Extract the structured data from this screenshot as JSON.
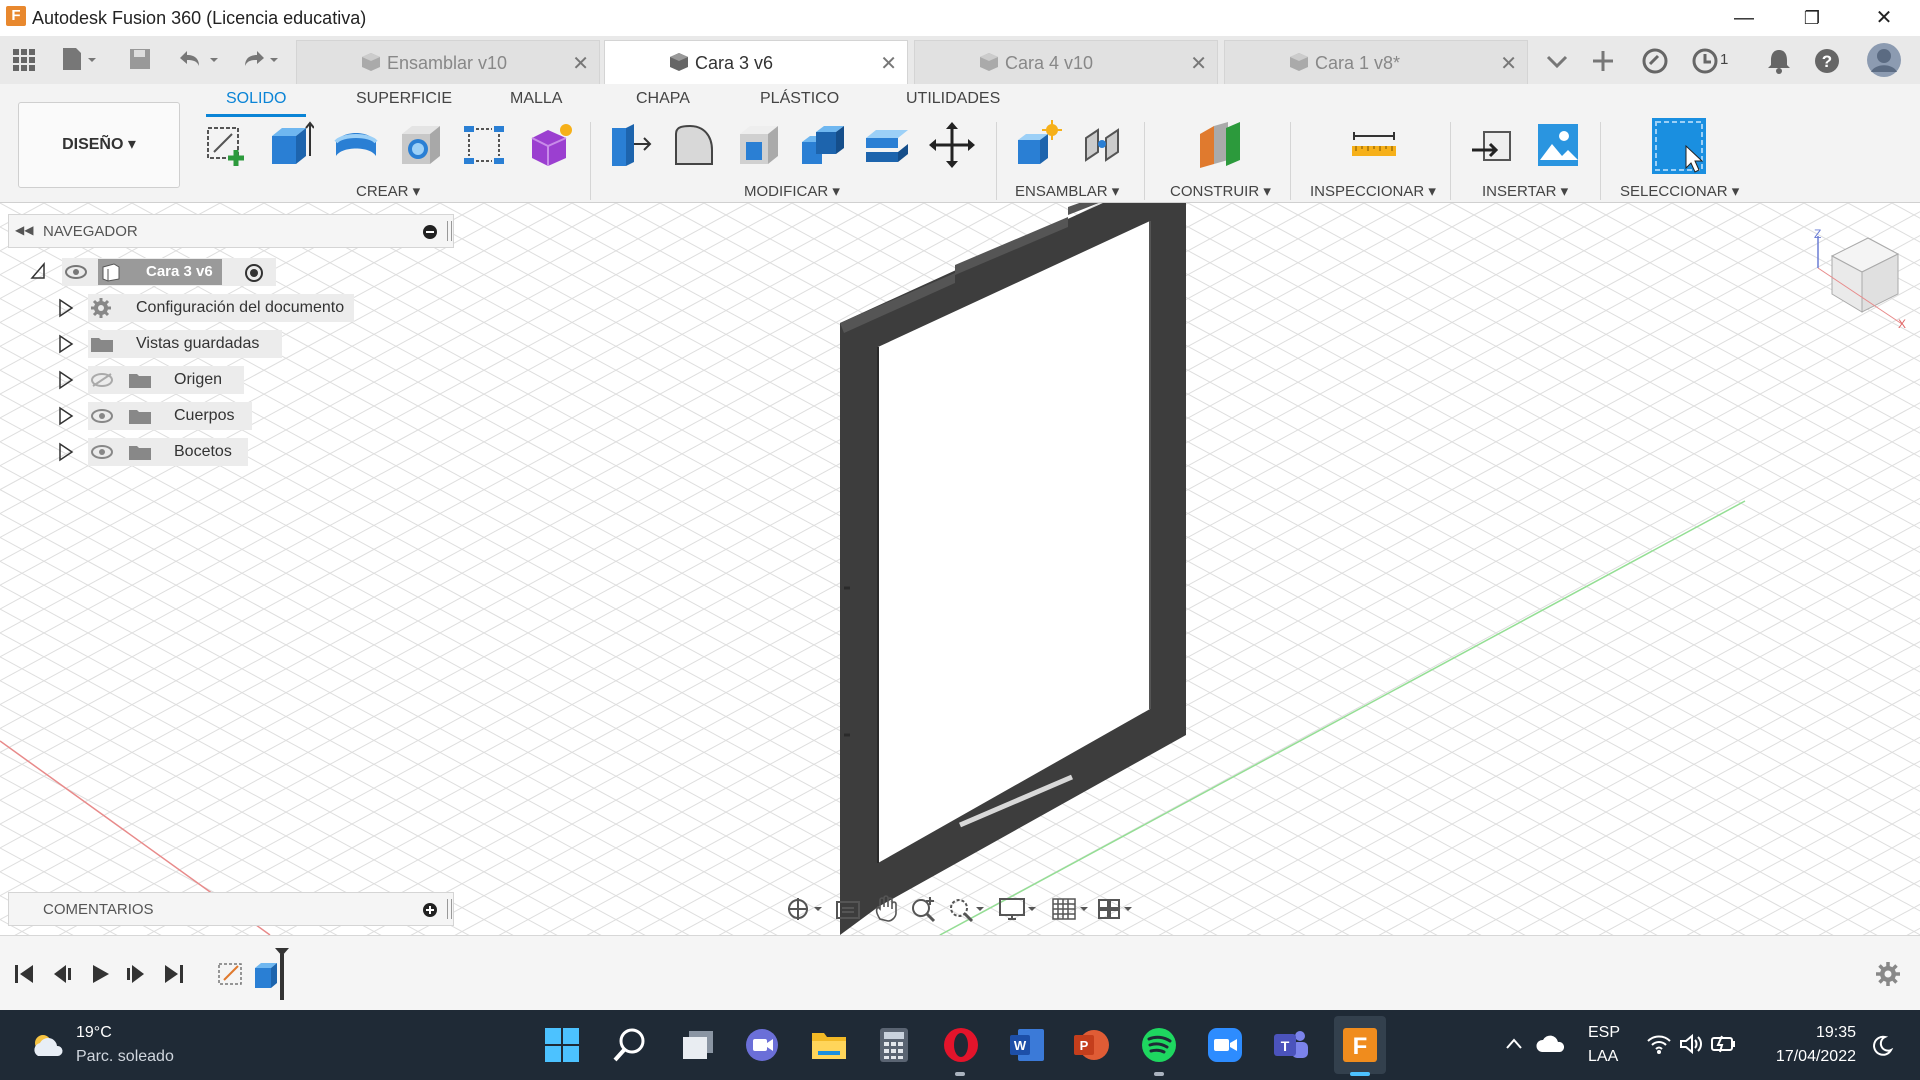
{
  "window": {
    "title": "Autodesk Fusion 360 (Licencia educativa)",
    "logo_letter": "F",
    "minimize": "—",
    "restore": "❐",
    "close": "✕"
  },
  "tabs": [
    {
      "label": "Ensamblar v10",
      "close": "✕"
    },
    {
      "label": "Cara 3 v6",
      "close": "✕"
    },
    {
      "label": "Cara 4 v10",
      "close": "✕"
    },
    {
      "label": "Cara 1 v8*",
      "close": "✕"
    }
  ],
  "tabbar_right": {
    "job_count": "1"
  },
  "workspace": {
    "label": "DISEÑO ▾"
  },
  "workspace_tabs": [
    "SOLIDO",
    "SUPERFICIE",
    "MALLA",
    "CHAPA",
    "PLÁSTICO",
    "UTILIDADES"
  ],
  "groups": [
    "CREAR ▾",
    "MODIFICAR ▾",
    "ENSAMBLAR ▾",
    "CONSTRUIR ▾",
    "INSPECCIONAR ▾",
    "INSERTAR ▾",
    "SELECCIONAR ▾"
  ],
  "navigator": {
    "title": "NAVEGADOR",
    "root": "Cara 3 v6",
    "items": [
      "Configuración del documento",
      "Vistas guardadas",
      "Origen",
      "Cuerpos",
      "Bocetos"
    ]
  },
  "comments": {
    "title": "COMENTARIOS"
  },
  "viewcube": {
    "axis_z": "Z",
    "axis_x": "X"
  },
  "taskbar": {
    "weather_temp": "19°C",
    "weather_desc": "Parc. soleado",
    "lang_top": "ESP",
    "lang_bottom": "LAA",
    "time": "19:35",
    "date": "17/04/2022"
  },
  "colors": {
    "accent": "#0a84d6",
    "taskbar": "#1f2a36",
    "frame": "#3d3d3d"
  }
}
